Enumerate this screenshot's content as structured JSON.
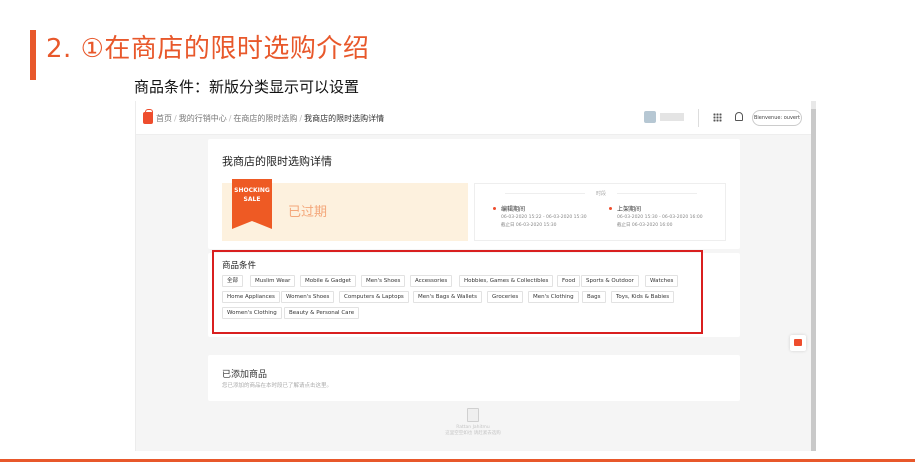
{
  "slide": {
    "title": "2. ①在商店的限时选购介绍",
    "subtitle": "商品条件：新版分类显示可以设置"
  },
  "header": {
    "breadcrumb": [
      "首页",
      "我的行销中心",
      "在商店的限时选购",
      "我商店的限时选购详情"
    ],
    "language_button": "Bienvenue: ouvert"
  },
  "detail": {
    "title": "我商店的限时选购详情",
    "sale_badge": "SHOCKING\nSALE",
    "status": "已过期",
    "period_label": "时段",
    "periods": [
      {
        "title": "编辑期间",
        "line1": "06-03-2020 15:22 - 06-03-2020 15:30",
        "line2": "截止日 06-03-2020 15:30"
      },
      {
        "title": "上架期间",
        "line1": "06-03-2020 15:30 - 06-03-2020 16:00",
        "line2": "截止日 06-03-2020 16:00"
      }
    ]
  },
  "conditions": {
    "title": "商品条件",
    "categories": [
      "全部",
      "Muslim Wear",
      "Mobile & Gadget",
      "Men's Shoes",
      "Accessories",
      "Hobbies, Games & Collectibles",
      "Food",
      "Sports & Outdoor",
      "Watches",
      "Home Appliances",
      "Women's Shoes",
      "Computers & Laptops",
      "Men's Bags & Wallets",
      "Groceries",
      "Men's Clothing",
      "Bags",
      "Toys, Kids & Babies",
      "Women's Clothing",
      "Beauty & Personal Care"
    ]
  },
  "added": {
    "title": "已添加商品",
    "subtitle": "您已添加的商品在本时段已了解请点击这里。",
    "empty_text": "Rattan Jahitmu\n这里空空如也 请赶紧去选购"
  },
  "colors": {
    "accent": "#e8582b",
    "shopee": "#ee4d2d",
    "highlight_box": "#d91f1f"
  }
}
